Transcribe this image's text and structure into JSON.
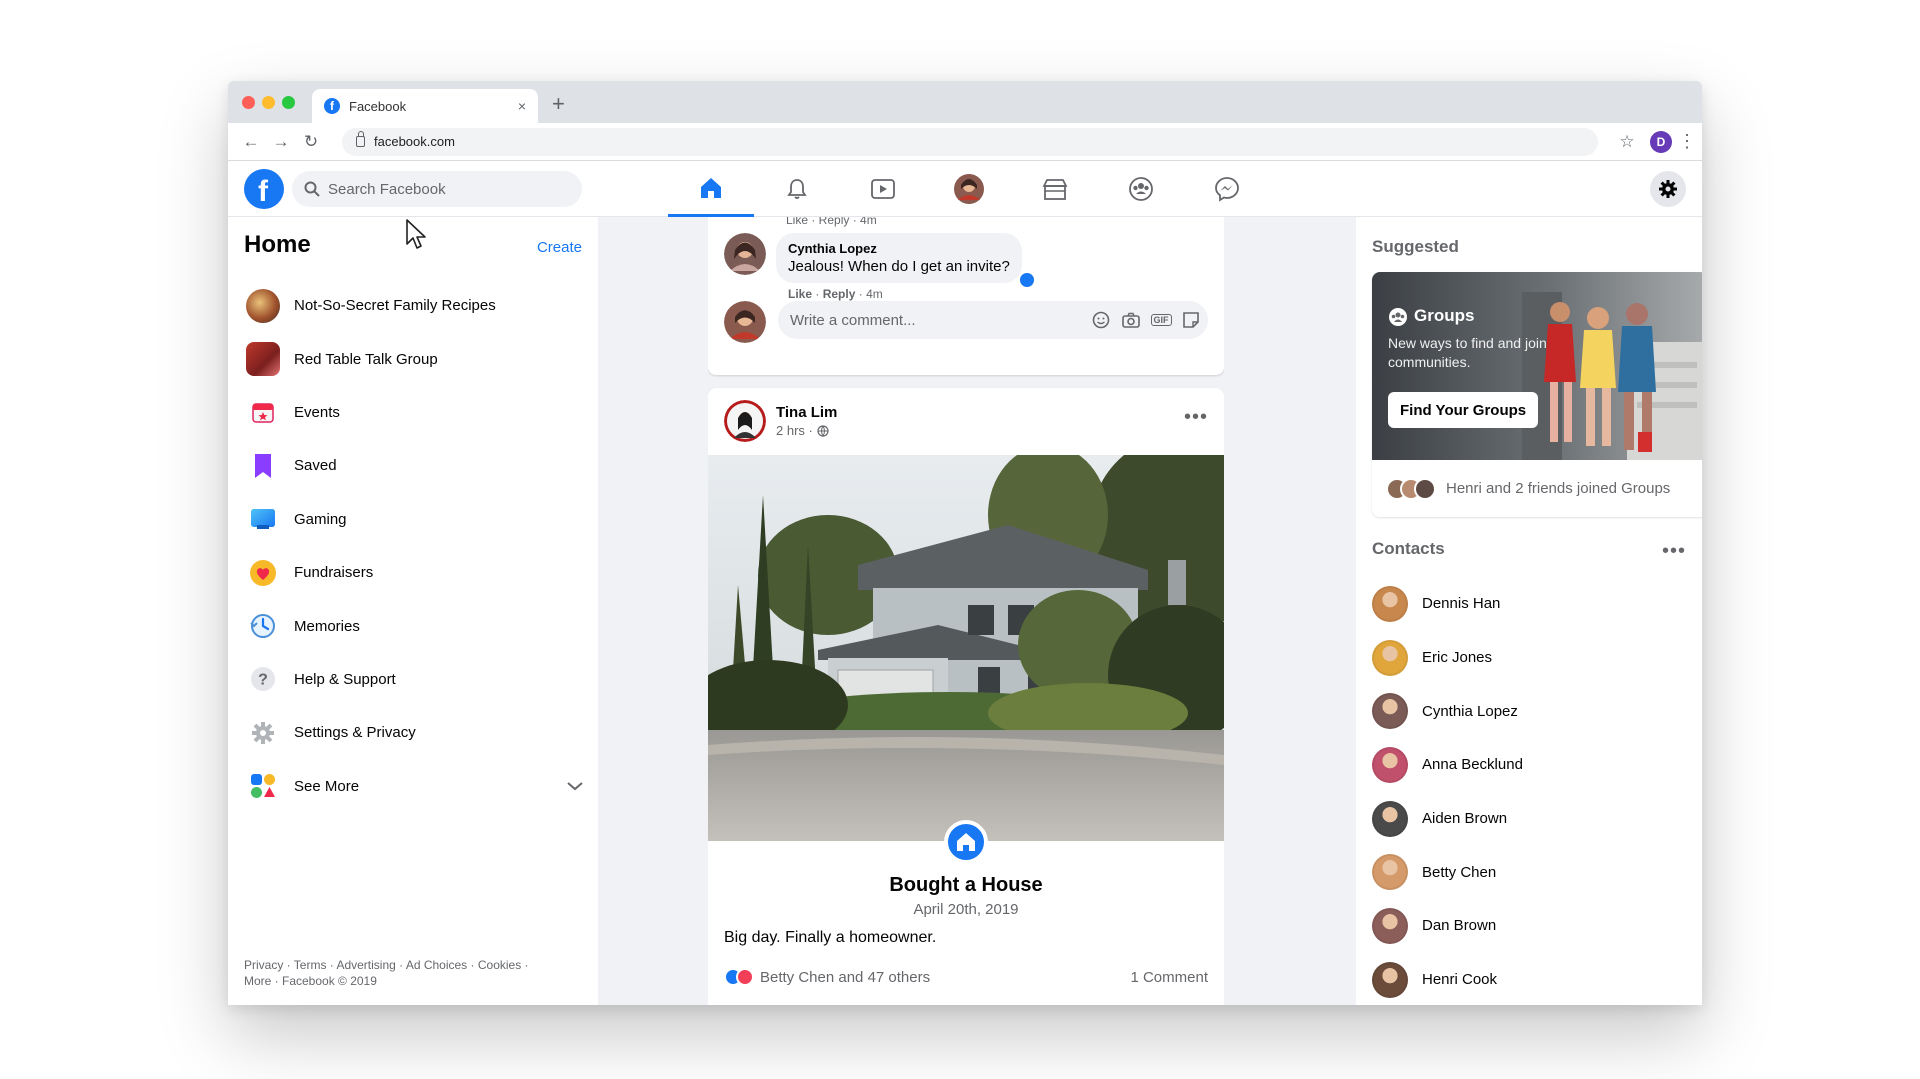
{
  "browser": {
    "tab_title": "Facebook",
    "tab_close": "×",
    "new_tab": "+",
    "url": "facebook.com",
    "profile_initial": "D"
  },
  "header": {
    "search_placeholder": "Search Facebook"
  },
  "sidebar": {
    "title": "Home",
    "create_label": "Create",
    "items": [
      {
        "label": "Not-So-Secret Family Recipes",
        "icon": "group-photo-icon"
      },
      {
        "label": "Red Table Talk Group",
        "icon": "group-photo-icon"
      },
      {
        "label": "Events",
        "icon": "calendar-icon"
      },
      {
        "label": "Saved",
        "icon": "bookmark-icon"
      },
      {
        "label": "Gaming",
        "icon": "gaming-icon"
      },
      {
        "label": "Fundraisers",
        "icon": "heart-icon"
      },
      {
        "label": "Memories",
        "icon": "clock-icon"
      },
      {
        "label": "Help & Support",
        "icon": "question-icon"
      },
      {
        "label": "Settings & Privacy",
        "icon": "gear-icon"
      },
      {
        "label": "See More",
        "icon": "apps-icon"
      }
    ],
    "footer_line1": "Privacy · Terms · Advertising · Ad Choices · Cookies ·",
    "footer_line2": "More · Facebook © 2019"
  },
  "feed": {
    "prev_comment_actions": "Like · Reply · 4m",
    "comment": {
      "author": "Cynthia Lopez",
      "text": "Jealous! When do I get an invite?",
      "like_label": "Like",
      "reply_label": "Reply",
      "time": "· 4m",
      "reaction_count": "1"
    },
    "write_placeholder": "Write a comment...",
    "write_gif": "GIF",
    "post": {
      "author": "Tina Lim",
      "time": "2 hrs ·",
      "more": "•••",
      "life_event_title": "Bought a House",
      "life_event_date": "April 20th, 2019",
      "text": "Big day. Finally a homeowner.",
      "reactions": "Betty Chen and 47 others",
      "comments": "1 Comment"
    }
  },
  "rightrail": {
    "suggested_title": "Suggested",
    "groups_card": {
      "title": "Groups",
      "desc": "New ways to find and join communities.",
      "button": "Find Your Groups",
      "footer": "Henri and 2 friends joined Groups"
    },
    "contacts_title": "Contacts",
    "contacts_more": "•••",
    "contacts": [
      {
        "name": "Dennis Han",
        "color": "#c8874d"
      },
      {
        "name": "Eric Jones",
        "color": "#e0a63c"
      },
      {
        "name": "Cynthia Lopez",
        "color": "#7a5b55"
      },
      {
        "name": "Anna Becklund",
        "color": "#c0506b"
      },
      {
        "name": "Aiden Brown",
        "color": "#4a4a4a"
      },
      {
        "name": "Betty Chen",
        "color": "#d49a6a"
      },
      {
        "name": "Dan Brown",
        "color": "#8b5e5a"
      },
      {
        "name": "Henri Cook",
        "color": "#6b4c3b"
      }
    ]
  },
  "colors": {
    "brand": "#1877f2",
    "background": "#f0f2f5"
  }
}
